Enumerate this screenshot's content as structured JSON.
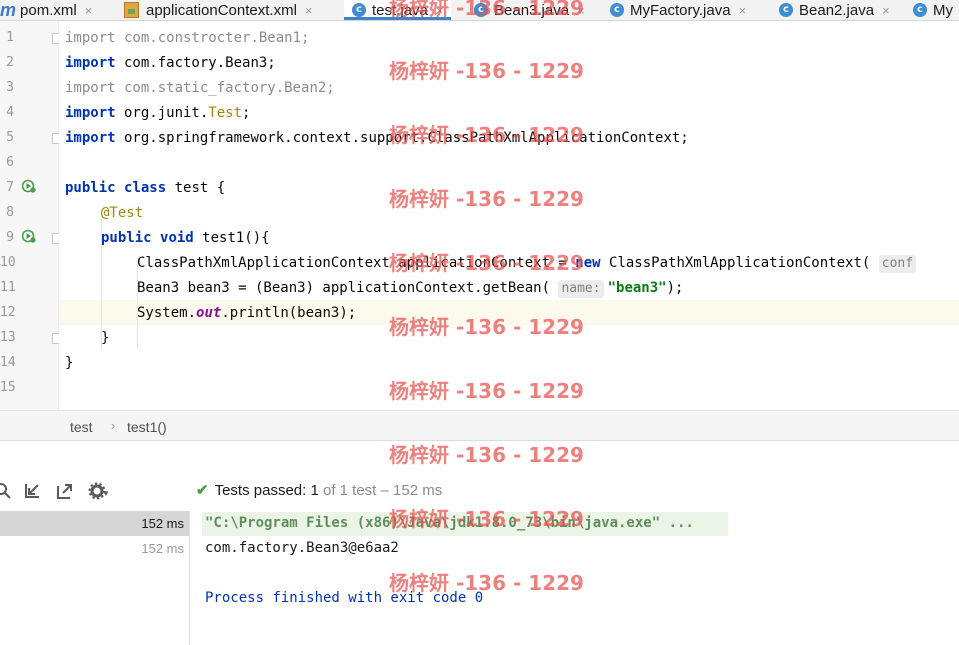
{
  "tabs": [
    {
      "label": "pom.xml",
      "icon": "maven-icon",
      "close": "×"
    },
    {
      "label": "applicationContext.xml",
      "icon": "xml-file-icon",
      "close": "×"
    },
    {
      "label": "test.java",
      "icon": "java-class-icon",
      "close": "×",
      "active": true
    },
    {
      "label": "Bean3.java",
      "icon": "java-class-icon",
      "close": "×"
    },
    {
      "label": "MyFactory.java",
      "icon": "java-class-icon",
      "close": "×"
    },
    {
      "label": "Bean2.java",
      "icon": "java-class-icon",
      "close": "×"
    },
    {
      "label": "My",
      "icon": "java-class-icon"
    }
  ],
  "tab_icon_letter": "c",
  "maven_letter": "m",
  "gutter": {
    "line_numbers": [
      "1",
      "2",
      "3",
      "4",
      "5",
      "6",
      "7",
      "8",
      "9",
      "10",
      "11",
      "12",
      "13",
      "14",
      "15"
    ],
    "run_icons": [
      "run-test-class-icon",
      "run-test-method-icon"
    ]
  },
  "code": {
    "l1": {
      "kw": "import",
      "rest": " com.constrocter.Bean1;"
    },
    "l2": {
      "kw": "import",
      "rest": " com.factory.Bean3;"
    },
    "l3": {
      "kw": "import",
      "rest": " com.static_factory.Bean2;"
    },
    "l4": {
      "kw": "import",
      "rest": " org.junit.",
      "ann": "Test",
      "end": ";"
    },
    "l5": {
      "kw": "import",
      "rest": " org.springframework.context.support.ClassPathXmlApplicationContext;"
    },
    "l7": {
      "kw1": "public",
      "kw2": "class",
      "rest": " test {"
    },
    "l8": {
      "ann": "@Test"
    },
    "l9": {
      "kw1": "public",
      "kw2": "void",
      "rest": " test1(){"
    },
    "l10": {
      "a": "ClassPathXmlApplicationContext applicationContext = ",
      "kw": "new",
      "b": " ClassPathXmlApplicationContext(",
      "hint": "conf"
    },
    "l11": {
      "a": "Bean3 bean3 = (Bean3) applicationContext.getBean(",
      "hint": "name:",
      "str": "\"bean3\"",
      "end": ");"
    },
    "l12": {
      "a": "System.",
      "static": "out",
      "b": ".println(bean3);"
    },
    "l13": "}",
    "l14": "}"
  },
  "breadcrumb": [
    "test",
    "test1()"
  ],
  "breadcrumb_sep": "›",
  "run_toolbar": {
    "icons": [
      "search-icon",
      "import-tests-icon",
      "export-tests-icon",
      "settings-icon"
    ]
  },
  "status": {
    "check": "✔",
    "label": "Tests passed:",
    "passed": "1",
    "rest": "of 1 test – 152 ms"
  },
  "tree": [
    {
      "time": "152 ms",
      "selected": true
    },
    {
      "time": "152 ms",
      "selected": false
    }
  ],
  "console": {
    "cmd": "\"C:\\Program Files (x86)\\Java\\jdk1.8.0_73\\bin\\java.exe\" ...",
    "output": "com.factory.Bean3@e6aa2",
    "finish": "Process finished with exit code 0"
  },
  "watermark": "杨梓妍 -136 - 1229",
  "colors": {
    "keyword": "#0033b3",
    "string": "#067d17",
    "annotation": "#9e880d",
    "static_field": "#871094",
    "console_cmd": "#067d17",
    "console_finish": "#0033b3",
    "watermark": "#e8504e",
    "success": "#4a9c4e"
  }
}
